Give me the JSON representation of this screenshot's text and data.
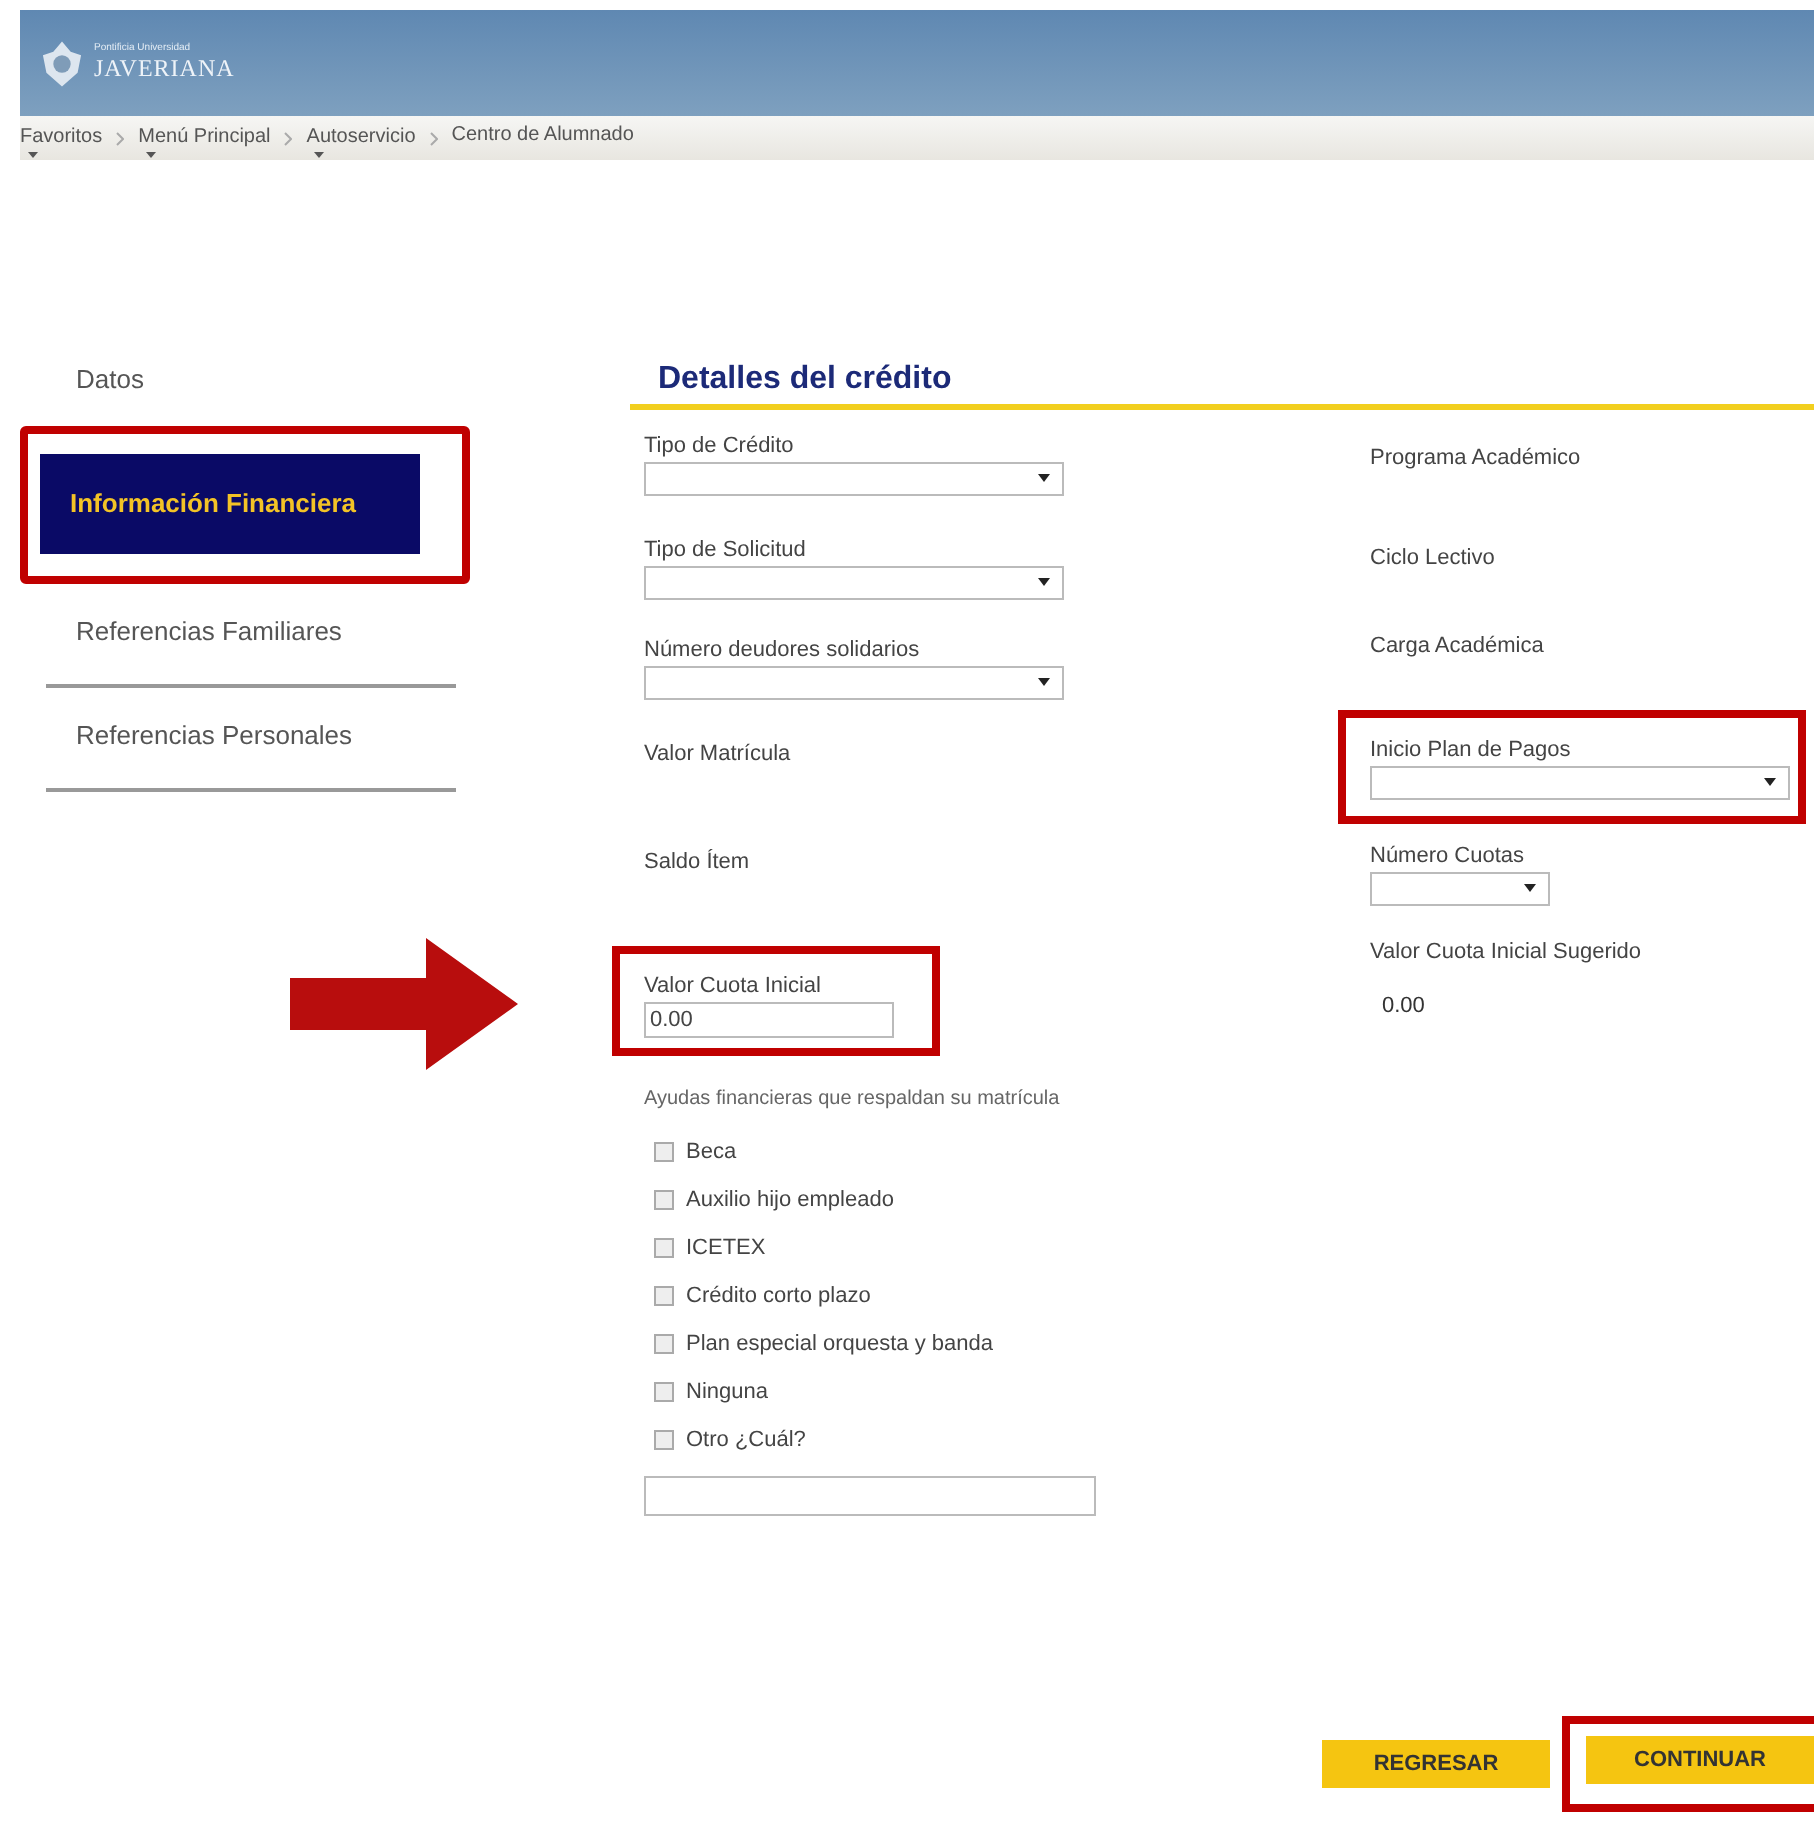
{
  "header": {
    "logo_small": "Pontificia Universidad",
    "logo_name": "JAVERIANA"
  },
  "breadcrumb": [
    {
      "label": "Favoritos",
      "dropdown": true
    },
    {
      "label": "Menú Principal",
      "dropdown": true
    },
    {
      "label": "Autoservicio",
      "dropdown": true
    },
    {
      "label": "Centro de Alumnado",
      "dropdown": false
    }
  ],
  "sidebar": {
    "items": [
      {
        "label": "Datos",
        "selected": false,
        "highlighted": false
      },
      {
        "label": "Información Financiera",
        "selected": true,
        "highlighted": true
      },
      {
        "label": "Referencias Familiares",
        "selected": false,
        "highlighted": false
      },
      {
        "label": "Referencias Personales",
        "selected": false,
        "highlighted": false
      }
    ]
  },
  "section_title": "Detalles del crédito",
  "left_fields": [
    {
      "kind": "select",
      "label": "Tipo de Crédito",
      "highlighted": false
    },
    {
      "kind": "select",
      "label": "Tipo de Solicitud",
      "highlighted": false
    },
    {
      "kind": "select",
      "label": "Número deudores solidarios",
      "highlighted": false
    },
    {
      "kind": "label",
      "label": "Valor Matrícula",
      "highlighted": false
    },
    {
      "kind": "label",
      "label": "Saldo Ítem",
      "highlighted": false
    },
    {
      "kind": "input",
      "label": "Valor Cuota Inicial",
      "value": "0.00",
      "highlighted": true,
      "arrow": true
    }
  ],
  "right_fields": [
    {
      "kind": "label",
      "label": "Programa Académico",
      "highlighted": false
    },
    {
      "kind": "label",
      "label": "Ciclo Lectivo",
      "highlighted": false
    },
    {
      "kind": "label",
      "label": "Carga Académica",
      "highlighted": false
    },
    {
      "kind": "select",
      "label": "Inicio Plan de Pagos",
      "highlighted": true
    },
    {
      "kind": "small-select",
      "label": "Número Cuotas",
      "highlighted": false
    },
    {
      "kind": "value",
      "label": "Valor Cuota Inicial Sugerido",
      "value": "0.00",
      "highlighted": false
    }
  ],
  "aids": {
    "title": "Ayudas financieras que respaldan su matrícula",
    "options": [
      {
        "label": "Beca",
        "checked": false
      },
      {
        "label": "Auxilio hijo empleado",
        "checked": false
      },
      {
        "label": "ICETEX",
        "checked": false
      },
      {
        "label": "Crédito corto plazo",
        "checked": false
      },
      {
        "label": "Plan especial orquesta y banda",
        "checked": false
      },
      {
        "label": "Ninguna",
        "checked": false
      },
      {
        "label": "Otro  ¿Cuál?",
        "checked": false
      }
    ]
  },
  "buttons": [
    {
      "label": "REGRESAR",
      "highlighted": false
    },
    {
      "label": "CONTINUAR",
      "highlighted": true
    }
  ]
}
